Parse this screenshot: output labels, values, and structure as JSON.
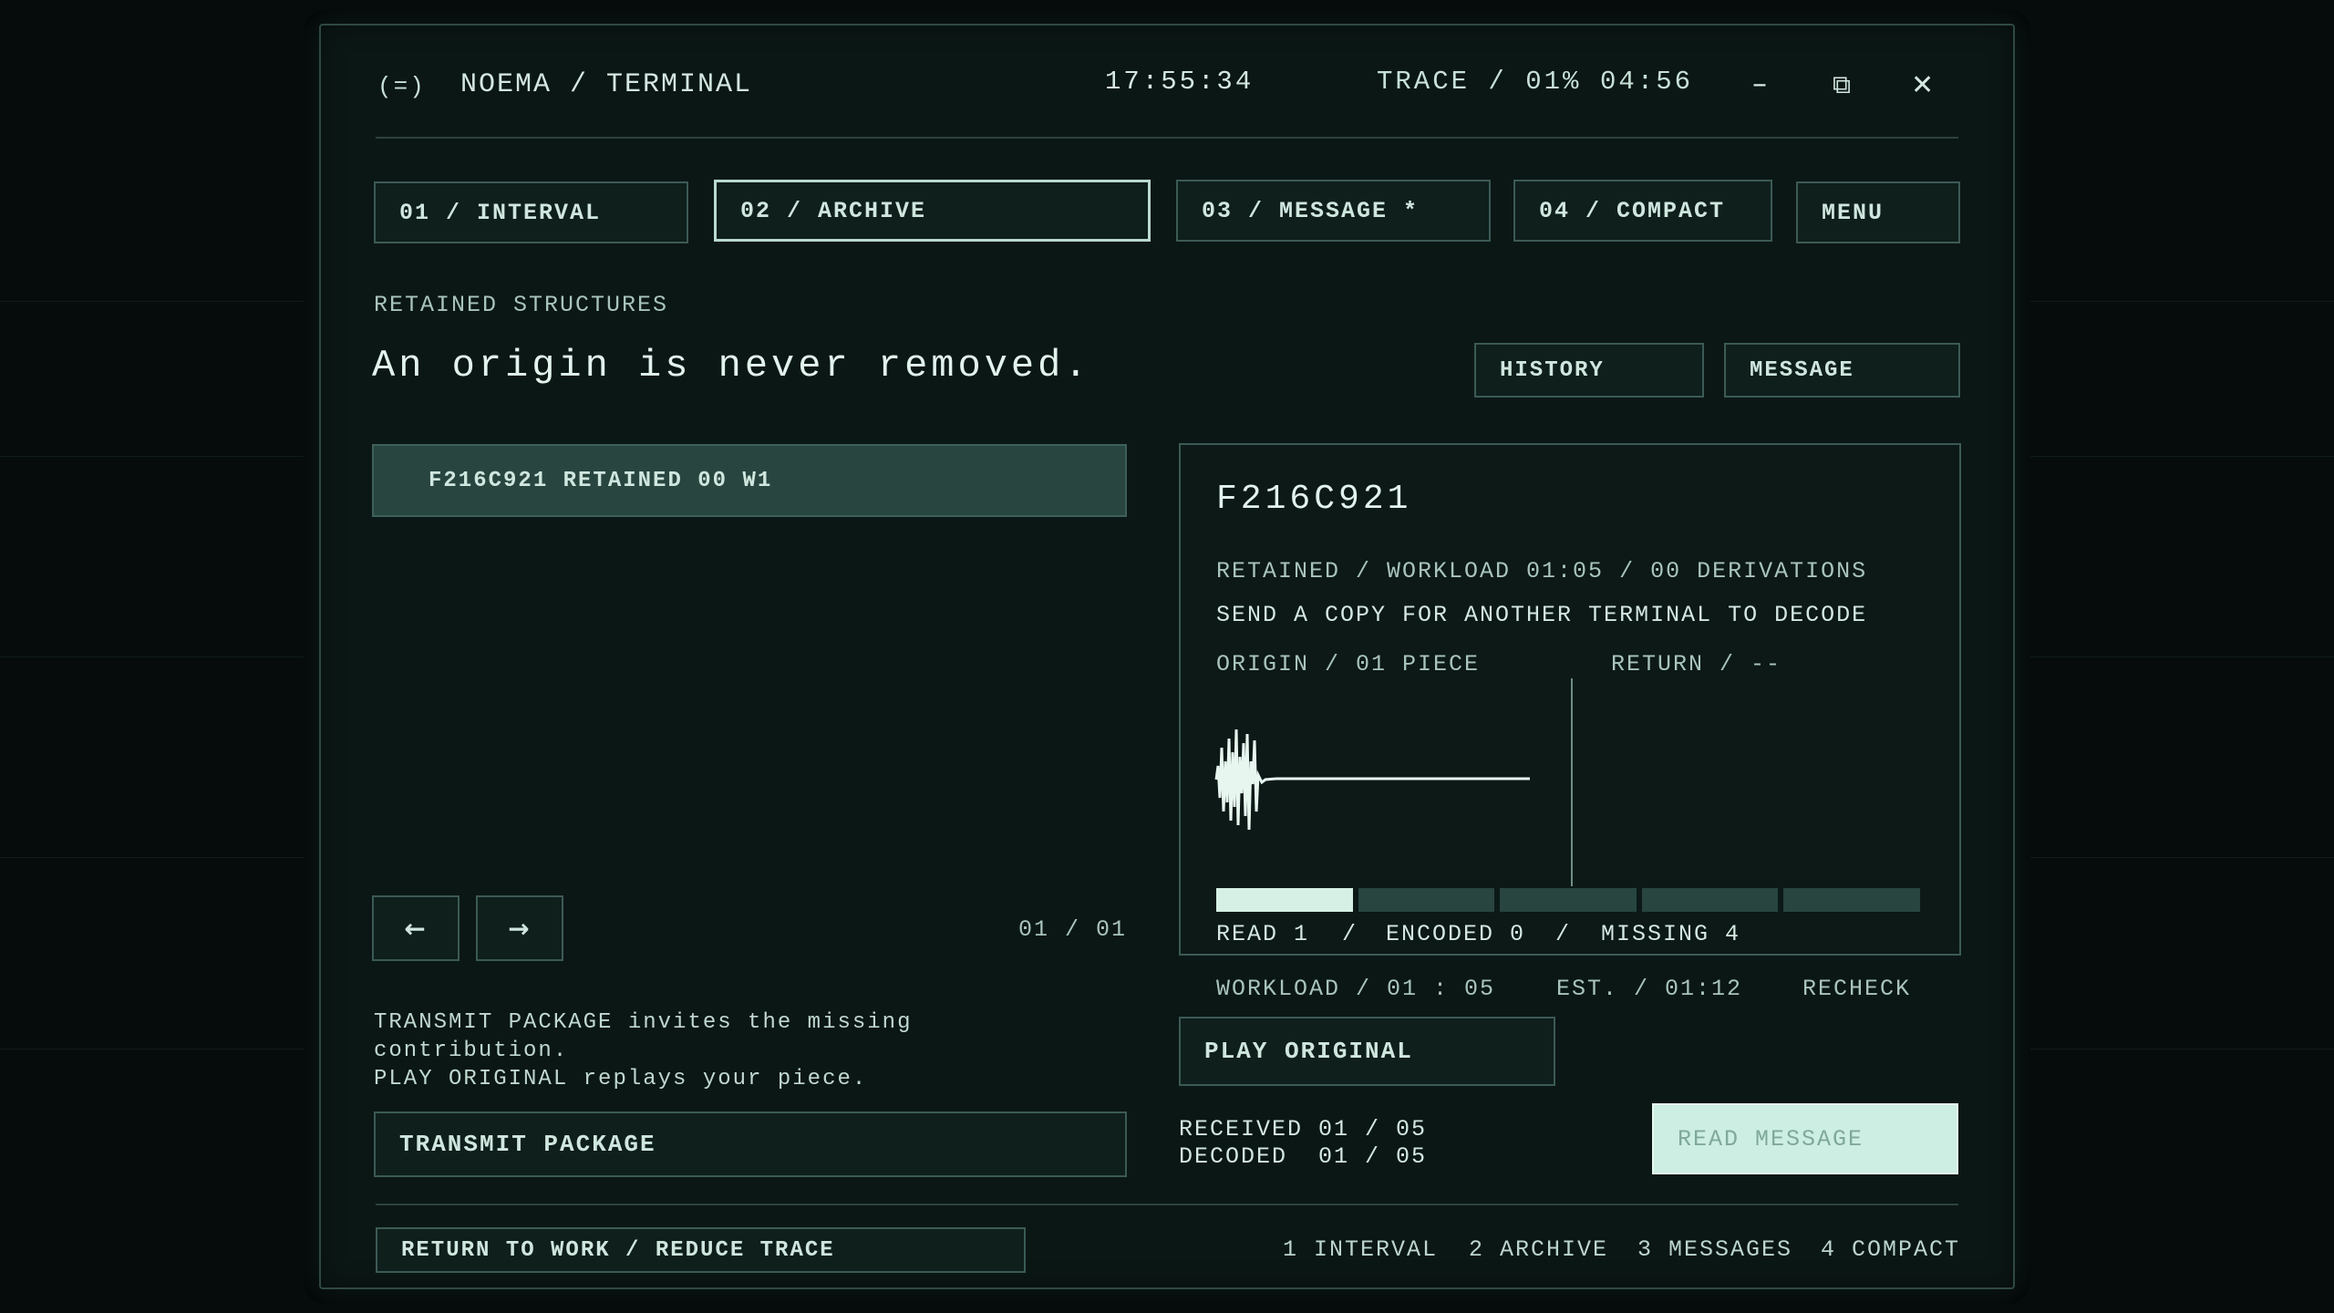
{
  "header": {
    "logo_glyph": "(=)",
    "title": "NOEMA / TERMINAL",
    "clock": "17:55:34",
    "trace": "TRACE / 01%",
    "timer": "04:56",
    "minimize_glyph": "–",
    "restore_glyph": "⧉",
    "close_glyph": "✕"
  },
  "tabs": [
    {
      "label": "01 / INTERVAL"
    },
    {
      "label": "02 / ARCHIVE"
    },
    {
      "label": "03 / MESSAGE *"
    },
    {
      "label": "04 / COMPACT"
    },
    {
      "label": "MENU"
    }
  ],
  "section": {
    "label": "RETAINED STRUCTURES",
    "heading": "An origin is never removed.",
    "history_button": "HISTORY",
    "message_button": "MESSAGE"
  },
  "list": {
    "items": [
      {
        "label": "F216C921  RETAINED  00  W1"
      }
    ],
    "prev_glyph": "←",
    "next_glyph": "→",
    "page": "01 / 01"
  },
  "help": {
    "line1": "TRANSMIT PACKAGE invites the missing",
    "line2": "contribution.",
    "line3": "PLAY ORIGINAL replays your piece."
  },
  "transmit_button": "TRANSMIT PACKAGE",
  "detail": {
    "id": "F216C921",
    "meta": "RETAINED / WORKLOAD 01:05 / 00 DERIVATIONS",
    "instruction": "SEND A COPY FOR ANOTHER TERMINAL TO DECODE",
    "origin": "ORIGIN / 01 PIECE",
    "return": "RETURN / --",
    "progress": {
      "segments": 5,
      "filled": 1
    },
    "status": {
      "read": "READ 1",
      "encoded": "ENCODED 0",
      "missing": "MISSING 4",
      "sep": "/"
    }
  },
  "workload": {
    "workload": "WORKLOAD / 01 : 05",
    "estimate": "EST. / 01:12",
    "recheck": "RECHECK"
  },
  "play_button": "PLAY ORIGINAL",
  "counts": {
    "received": "RECEIVED 01 / 05",
    "decoded": "DECODED  01 / 05"
  },
  "read_button": "READ MESSAGE",
  "footer": {
    "return_button": "RETURN TO WORK / REDUCE TRACE",
    "shortcuts": [
      {
        "label": "1 INTERVAL"
      },
      {
        "label": "2 ARCHIVE"
      },
      {
        "label": "3 MESSAGES"
      },
      {
        "label": "4 COMPACT"
      }
    ]
  },
  "colors": {
    "background": "#060c0b",
    "panel": "#0b1715",
    "accent": "#d6f0e6",
    "border": "#3c5a55"
  }
}
